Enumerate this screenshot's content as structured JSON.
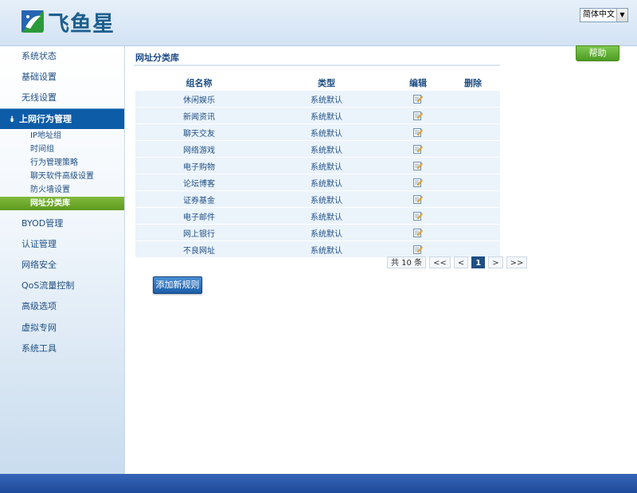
{
  "header": {
    "brand": "飞鱼星",
    "language": "简体中文",
    "logo_icon": "fish-star-logo"
  },
  "sidebar": {
    "items": [
      {
        "label": "系统状态"
      },
      {
        "label": "基础设置"
      },
      {
        "label": "无线设置"
      },
      {
        "label": "上网行为管理",
        "active": true
      },
      {
        "label": "BYOD管理"
      },
      {
        "label": "认证管理"
      },
      {
        "label": "网络安全"
      },
      {
        "label": "QoS流量控制"
      },
      {
        "label": "高级选项"
      },
      {
        "label": "虚拟专网"
      },
      {
        "label": "系统工具"
      }
    ],
    "subitems": [
      {
        "label": "IP地址组"
      },
      {
        "label": "时间组"
      },
      {
        "label": "行为管理策略"
      },
      {
        "label": "聊天软件高级设置"
      },
      {
        "label": "防火墙设置"
      },
      {
        "label": "网址分类库",
        "active": true
      }
    ],
    "active_color": "#0d5ca8",
    "sub_active_color": "#6aa62a"
  },
  "main": {
    "title": "网址分类库",
    "help_label": "帮助",
    "columns": [
      "组名称",
      "类型",
      "编辑",
      "删除"
    ],
    "rows": [
      {
        "name": "休闲娱乐",
        "type": "系统默认"
      },
      {
        "name": "新闻资讯",
        "type": "系统默认"
      },
      {
        "name": "聊天交友",
        "type": "系统默认"
      },
      {
        "name": "网络游戏",
        "type": "系统默认"
      },
      {
        "name": "电子购物",
        "type": "系统默认"
      },
      {
        "name": "论坛博客",
        "type": "系统默认"
      },
      {
        "name": "证券基金",
        "type": "系统默认"
      },
      {
        "name": "电子邮件",
        "type": "系统默认"
      },
      {
        "name": "网上银行",
        "type": "系统默认"
      },
      {
        "name": "不良网址",
        "type": "系统默认"
      }
    ],
    "pager": {
      "total": "共 10 条",
      "first": "<<",
      "prev": "<",
      "current": "1",
      "next": ">",
      "last": ">>"
    },
    "add_button": "添加新规则"
  }
}
